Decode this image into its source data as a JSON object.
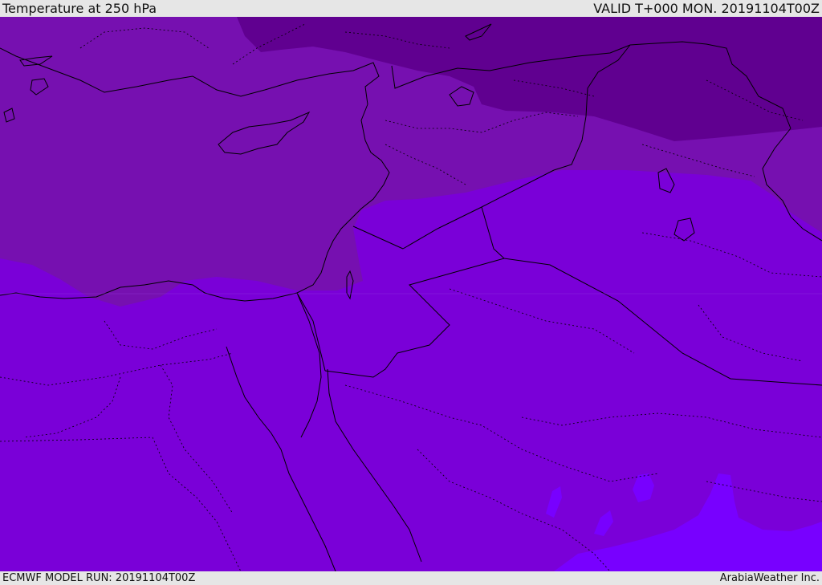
{
  "header": {
    "title": "Temperature at 250 hPa",
    "valid": "VALID T+000 MON. 20191104T00Z"
  },
  "footer": {
    "model_run": "ECMWF MODEL RUN: 20191104T00Z",
    "credit": "ArabiaWeather Inc."
  },
  "colors": {
    "frame": "#e6e6e6",
    "band_coldest": "#600090",
    "band_cold": "#7610b0",
    "band_main": "#7a00d8",
    "band_warm": "#7800ff",
    "border_line": "#000000"
  }
}
